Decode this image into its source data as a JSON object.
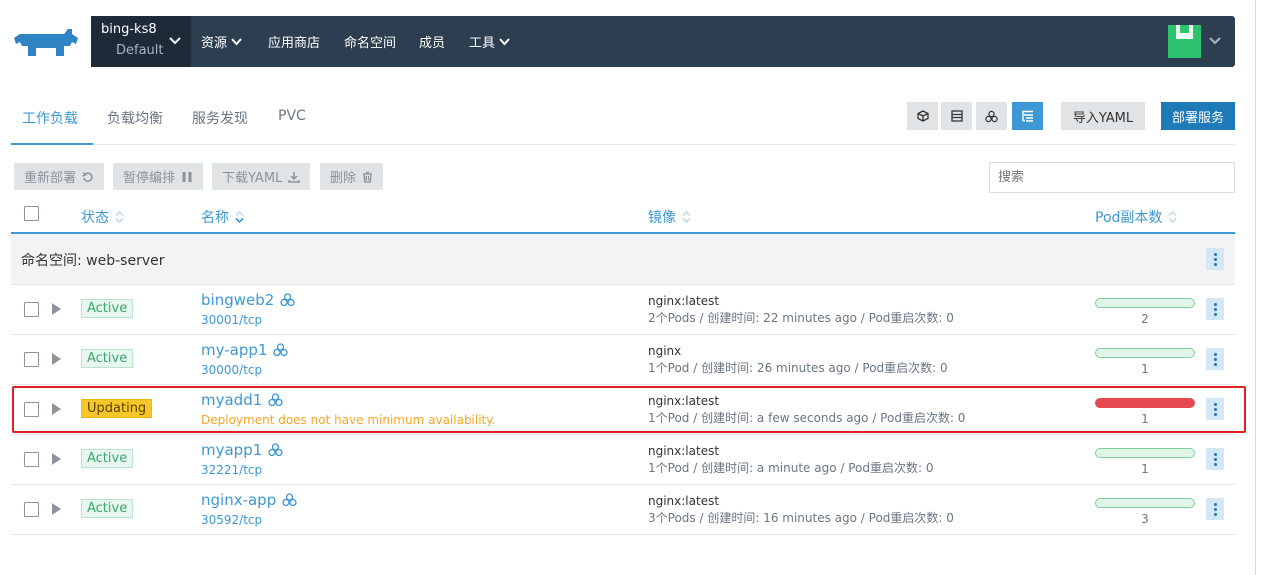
{
  "cluster": {
    "name": "bing-ks8",
    "project": "Default"
  },
  "nav": {
    "resources": "资源",
    "app_store": "应用商店",
    "namespaces": "命名空间",
    "members": "成员",
    "tools": "工具"
  },
  "tabs": [
    {
      "label": "工作负载"
    },
    {
      "label": "负载均衡"
    },
    {
      "label": "服务发现"
    },
    {
      "label": "PVC"
    }
  ],
  "buttons": {
    "import_yaml": "导入YAML",
    "deploy": "部署服务"
  },
  "actions": {
    "redeploy": "重新部署",
    "pause": "暂停编排",
    "download_yaml": "下载YAML",
    "delete": "删除"
  },
  "search": {
    "placeholder": "搜索"
  },
  "columns": {
    "status": "状态",
    "name": "名称",
    "image": "镜像",
    "pods": "Pod副本数"
  },
  "group": {
    "label": "命名空间: web-server"
  },
  "colors": {
    "accent": "#3d98d3",
    "active": "#3aa672",
    "updating": "#f7c628",
    "error_bar": "#e64950"
  },
  "rows": [
    {
      "status": "Active",
      "name": "bingweb2",
      "sub": "30001/tcp",
      "image": "nginx:latest",
      "meta": "2个Pods / 创建时间: 22 minutes ago / Pod重启次数: 0",
      "pods": "2"
    },
    {
      "status": "Active",
      "name": "my-app1",
      "sub": "30000/tcp",
      "image": "nginx",
      "meta": "1个Pod / 创建时间: 26 minutes ago / Pod重启次数: 0",
      "pods": "1"
    },
    {
      "status": "Updating",
      "name": "myadd1",
      "sub": "Deployment does not have minimum availability.",
      "image": "nginx:latest",
      "meta": "1个Pod / 创建时间: a few seconds ago / Pod重启次数: 0",
      "pods": "1"
    },
    {
      "status": "Active",
      "name": "myapp1",
      "sub": "32221/tcp",
      "image": "nginx:latest",
      "meta": "1个Pod / 创建时间: a minute ago / Pod重启次数: 0",
      "pods": "1"
    },
    {
      "status": "Active",
      "name": "nginx-app",
      "sub": "30592/tcp",
      "image": "nginx:latest",
      "meta": "3个Pods / 创建时间: 16 minutes ago / Pod重启次数: 0",
      "pods": "3"
    }
  ]
}
